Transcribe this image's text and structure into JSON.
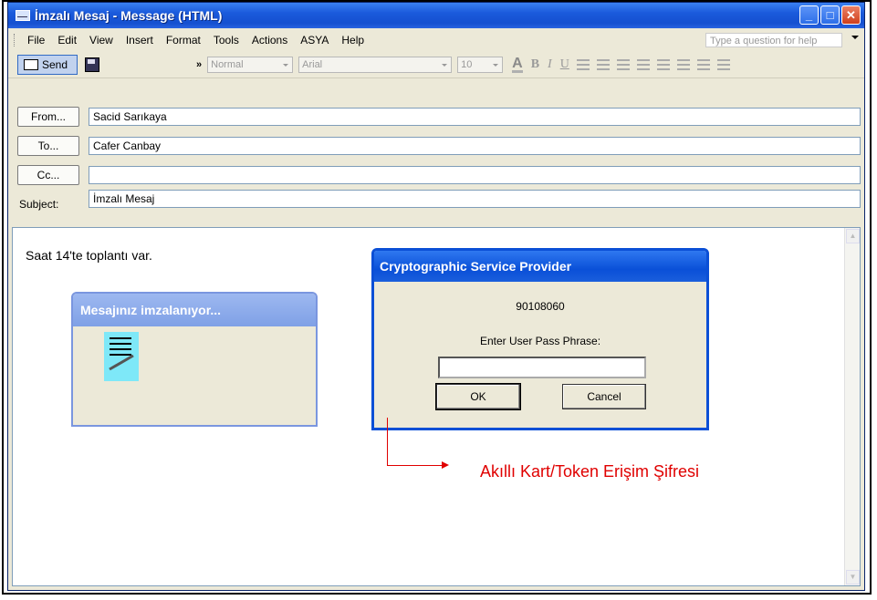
{
  "window": {
    "title": "İmzalı Mesaj - Message (HTML)"
  },
  "menubar": {
    "items": [
      "File",
      "Edit",
      "View",
      "Insert",
      "Format",
      "Tools",
      "Actions",
      "ASYA",
      "Help"
    ],
    "help_placeholder": "Type a question for help"
  },
  "toolbar": {
    "send_label": "Send",
    "style": "Normal",
    "font": "Arial",
    "size": "10",
    "bold": "B",
    "italic": "I",
    "underline": "U",
    "font_color": "A"
  },
  "header": {
    "from_label": "From...",
    "from_value": "Sacid Sarıkaya",
    "to_label": "To...",
    "to_value": "Cafer Canbay",
    "cc_label": "Cc...",
    "cc_value": "",
    "subject_label": "Subject:",
    "subject_value": "İmzalı Mesaj"
  },
  "body": {
    "text": "Saat 14'te toplantı var."
  },
  "signing_dialog": {
    "title": "Mesajınız imzalanıyor..."
  },
  "csp_dialog": {
    "title": "Cryptographic Service Provider",
    "code": "90108060",
    "prompt": "Enter User Pass Phrase:",
    "ok_label": "OK",
    "cancel_label": "Cancel"
  },
  "annotation": {
    "text": "Akıllı Kart/Token Erişim Şifresi",
    "color": "#e00000"
  }
}
